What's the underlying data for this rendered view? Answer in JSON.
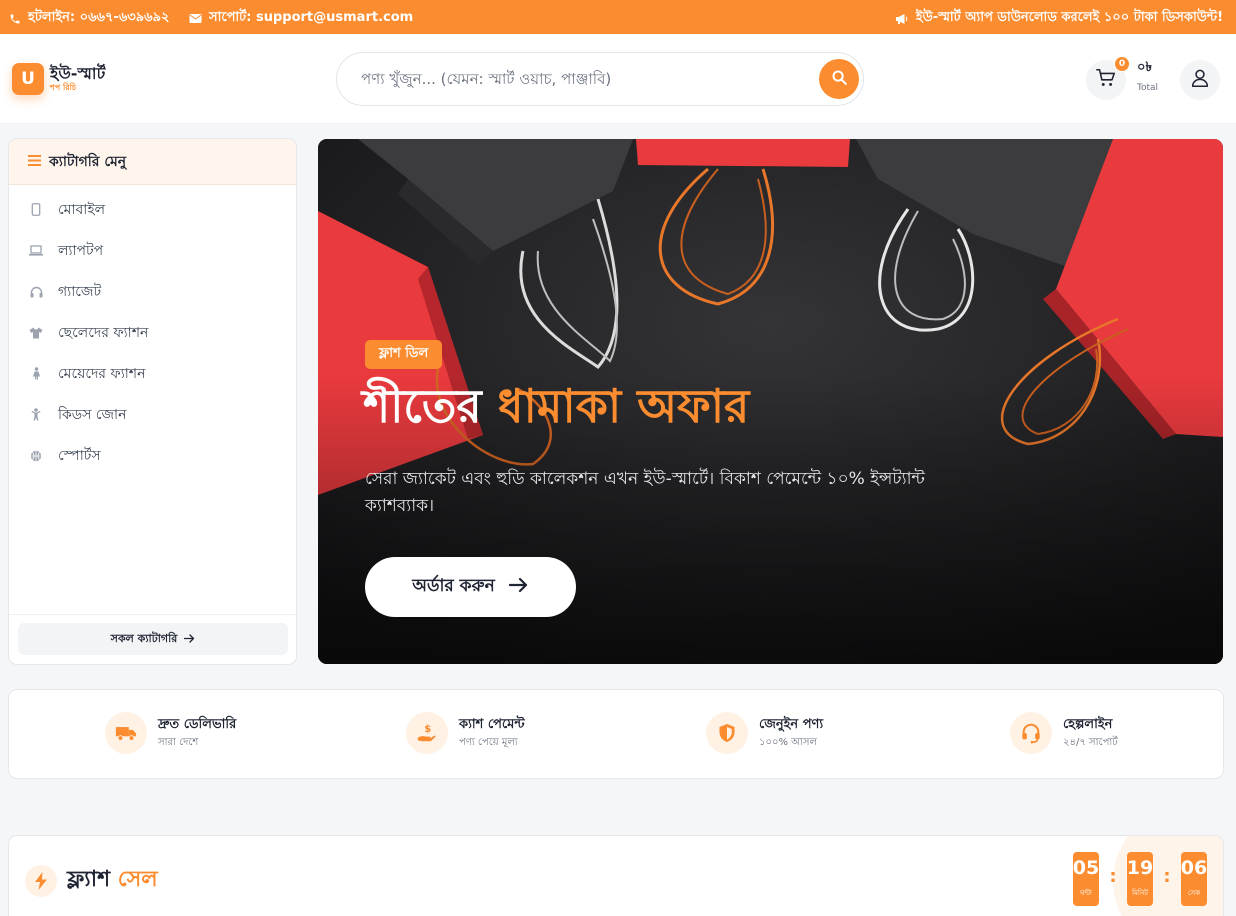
{
  "topbar": {
    "hotline": "হটলাইন: ০৬৬৭-৬৩৯৬৯২",
    "support": "সাপোর্ট: support@usmart.com",
    "promo": "ইউ-স্মার্ট অ্যাপ ডাউনলোড করলেই ১০০ টাকা ডিসকাউন্ট!"
  },
  "brand": {
    "badge": "U",
    "name": "ইউ-স্মার্ট",
    "tagline": "শপ রিচি"
  },
  "search": {
    "placeholder": "পণ্য খুঁজুন... (যেমন: স্মার্ট ওয়াচ, পাঞ্জাবি)"
  },
  "cart": {
    "count": "0",
    "amount": "০৳",
    "label": "Total"
  },
  "sidebar": {
    "title": "ক্যাটাগরি মেনু",
    "items": [
      {
        "label": "মোবাইল",
        "icon": "mobile-icon"
      },
      {
        "label": "ল্যাপটপ",
        "icon": "laptop-icon"
      },
      {
        "label": "গ্যাজেট",
        "icon": "headphones-icon"
      },
      {
        "label": "ছেলেদের ফ্যাশন",
        "icon": "tshirt-icon"
      },
      {
        "label": "মেয়েদের ফ্যাশন",
        "icon": "female-icon"
      },
      {
        "label": "কিডস জোন",
        "icon": "child-icon"
      },
      {
        "label": "স্পোর্টস",
        "icon": "ball-icon"
      }
    ],
    "all_label": "সকল ক্যাটাগরি"
  },
  "hero": {
    "tag": "ফ্লাশ ডিল",
    "title_white": "শীতের",
    "title_orange": "ধামাকা অফার",
    "description": "সেরা জ্যাকেট এবং হুডি কালেকশন এখন ইউ-স্মার্টে। বিকাশ পেমেন্টে ১০% ইন্সট্যান্ট ক্যাশব্যাক।",
    "cta": "অর্ডার করুন"
  },
  "features": [
    {
      "title": "দ্রুত ডেলিভারি",
      "subtitle": "সারা দেশে",
      "icon": "truck-icon"
    },
    {
      "title": "ক্যাশ পেমেন্ট",
      "subtitle": "পণ্য পেয়ে মূল্য",
      "icon": "cash-hand-icon"
    },
    {
      "title": "জেনুইন পণ্য",
      "subtitle": "১০০% আসল",
      "icon": "shield-icon"
    },
    {
      "title": "হেল্পলাইন",
      "subtitle": "২৪/৭ সাপোর্ট",
      "icon": "headset-icon"
    }
  ],
  "flash_sale": {
    "title_dark": "ফ্ল্যাশ",
    "title_orange": "সেল",
    "countdown": [
      {
        "value": "05",
        "label": "ঘন্টা"
      },
      {
        "value": "19",
        "label": "মিনিট"
      },
      {
        "value": "06",
        "label": "সেক"
      }
    ]
  },
  "colors": {
    "accent": "#fb8c2f",
    "text": "#1f2433",
    "hero_bg": "#1d1d20"
  }
}
